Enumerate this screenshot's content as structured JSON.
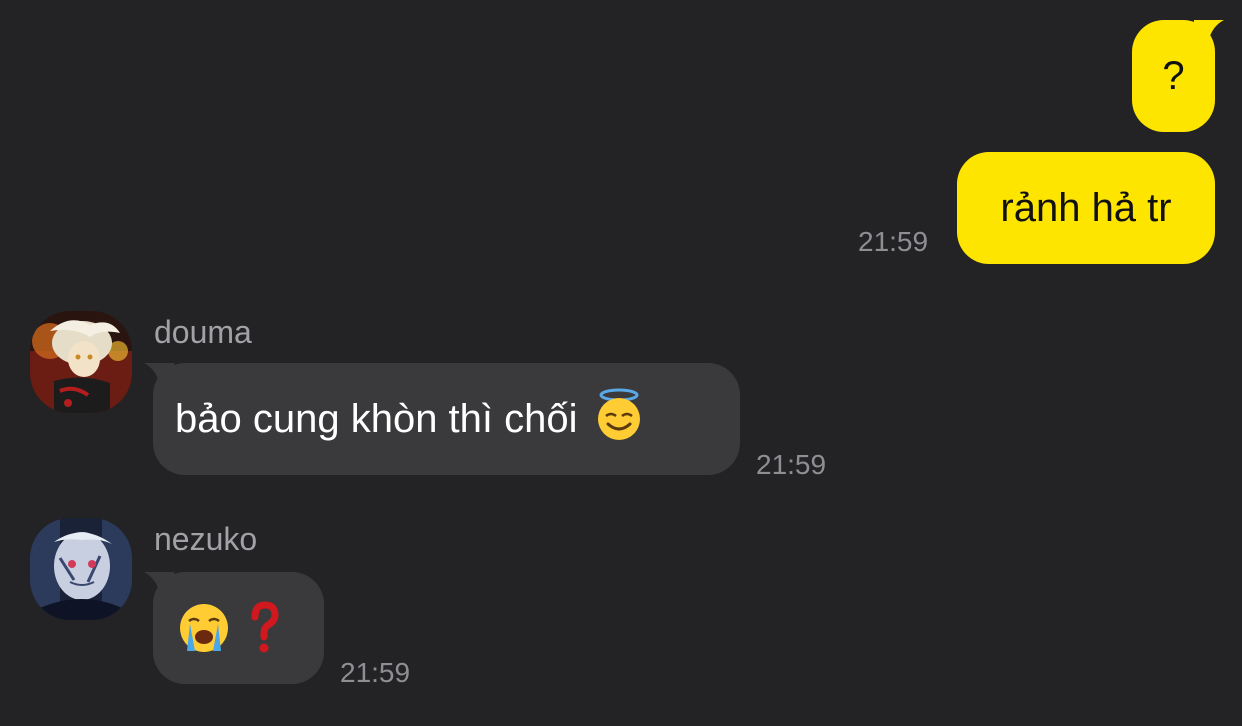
{
  "colors": {
    "background": "#232325",
    "outgoing_bubble": "#fee500",
    "incoming_bubble": "#3a3a3c",
    "timestamp": "#8e8e93",
    "sender_name": "#a1a1a6"
  },
  "messages": [
    {
      "direction": "outgoing",
      "text": "?",
      "time": ""
    },
    {
      "direction": "outgoing",
      "text": "rảnh hả tr",
      "time": "21:59"
    },
    {
      "direction": "incoming",
      "sender": "douma",
      "avatar": "avatar-douma",
      "text": "bảo cung khòn thì chối",
      "emoji": "smiling-face-with-halo",
      "time": "21:59"
    },
    {
      "direction": "incoming",
      "sender": "nezuko",
      "avatar": "avatar-nezuko",
      "text": "",
      "emoji": [
        "loudly-crying-face",
        "red-question-mark"
      ],
      "time": "21:59"
    }
  ]
}
